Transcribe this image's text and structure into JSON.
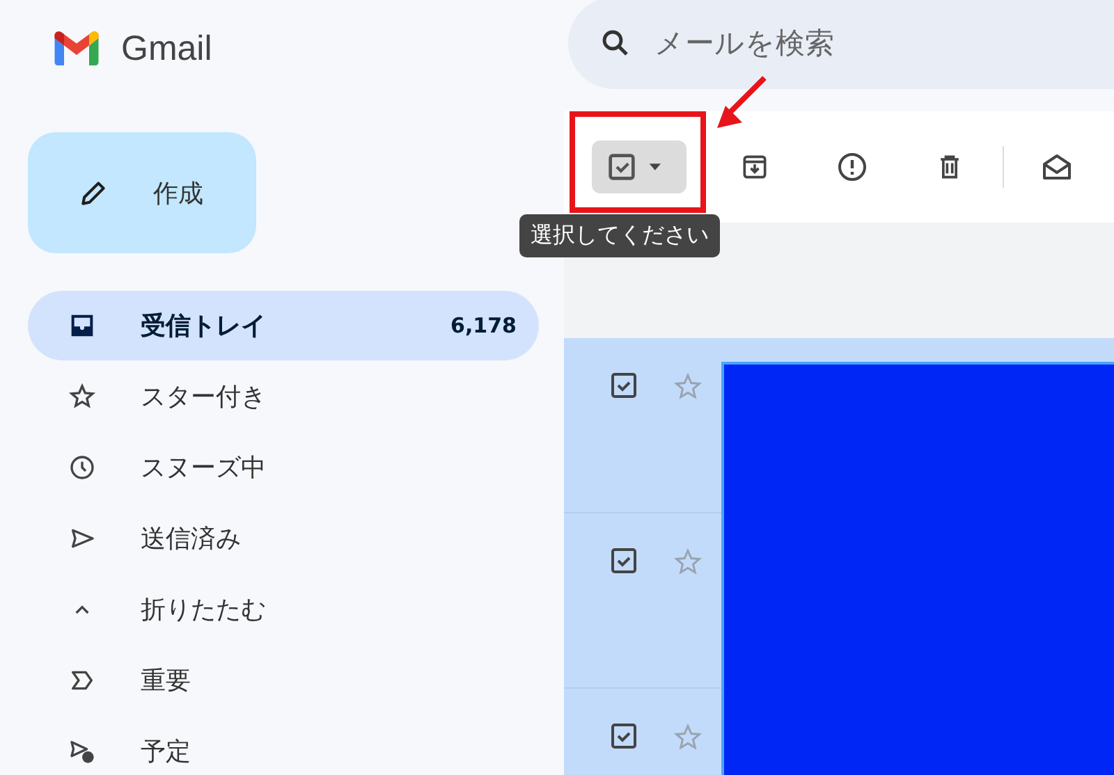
{
  "logo": {
    "text": "Gmail"
  },
  "search": {
    "placeholder": "メールを検索"
  },
  "compose": {
    "label": "作成"
  },
  "toolbar": {
    "select_button": {
      "pressed": true
    },
    "tooltip": "選択してください",
    "highlighted": true
  },
  "nav": [
    {
      "label": "受信トレイ",
      "kind": "inbox",
      "count": "6,178",
      "selected": true
    },
    {
      "label": "スター付き",
      "kind": "star",
      "selected": false
    },
    {
      "label": "スヌーズ中",
      "kind": "clock",
      "selected": false
    },
    {
      "label": "送信済み",
      "kind": "send",
      "selected": false
    },
    {
      "label": "折りたたむ",
      "kind": "collapse",
      "selected": false
    },
    {
      "label": "重要",
      "kind": "important",
      "selected": false
    },
    {
      "label": "予定",
      "kind": "scheduled",
      "selected": false
    }
  ],
  "rows": [
    {
      "checked": true,
      "starred": false
    },
    {
      "checked": true,
      "starred": false
    },
    {
      "checked": true,
      "starred": false
    }
  ]
}
